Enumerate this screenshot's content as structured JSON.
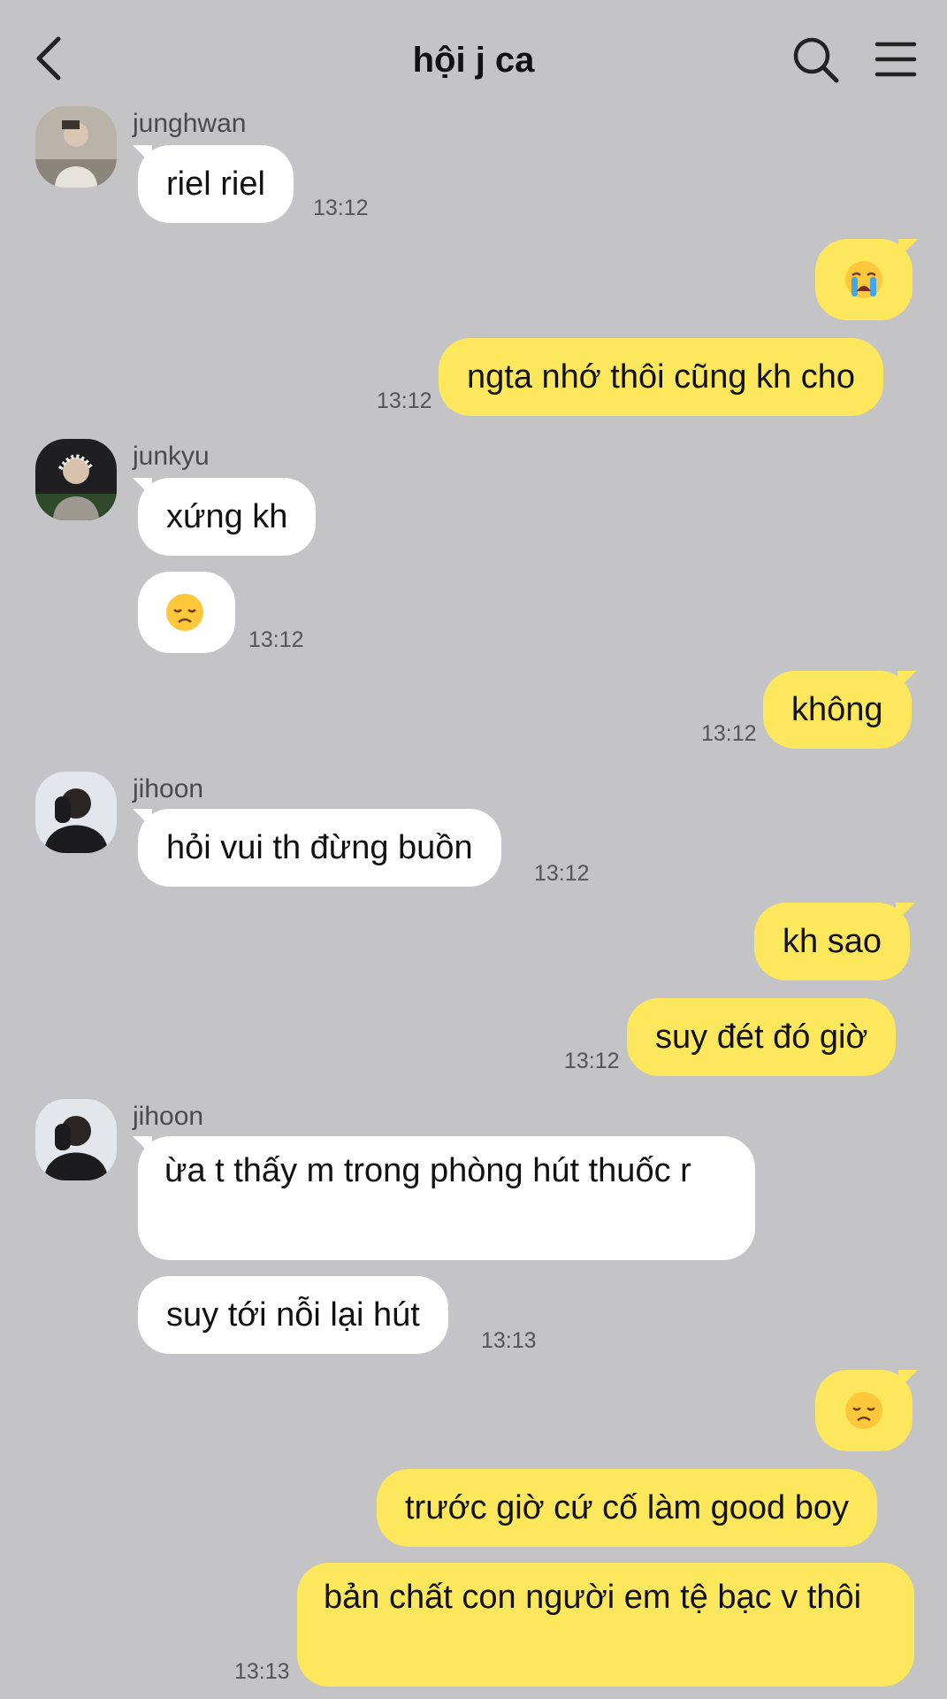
{
  "header": {
    "title": "hội j ca"
  },
  "colors": {
    "background": "#c4c4c6",
    "incoming_bubble": "#ffffff",
    "outgoing_bubble": "#fce75d"
  },
  "icons": [
    "back-arrow-icon",
    "search-icon",
    "menu-icon",
    "crying-emoji",
    "disappointed-emoji"
  ],
  "messages": [
    {
      "sender": "junghwan",
      "text": "riel riel",
      "time": "13:12"
    },
    {
      "emoji": "loudly-crying-face"
    },
    {
      "text": "ngta nhớ thôi cũng kh cho",
      "time": "13:12"
    },
    {
      "sender": "junkyu",
      "text": "xứng kh"
    },
    {
      "emoji": "disappointed-face",
      "time": "13:12"
    },
    {
      "text": "không",
      "time": "13:12"
    },
    {
      "sender": "jihoon",
      "text": "hỏi vui th đừng buồn",
      "time": "13:12"
    },
    {
      "text": "kh sao"
    },
    {
      "text": "suy đét đó giờ",
      "time": "13:12"
    },
    {
      "sender": "jihoon",
      "text": "ừa t thấy m trong phòng hút thuốc r"
    },
    {
      "text": "suy tới nỗi lại hút",
      "time": "13:13"
    },
    {
      "emoji": "disappointed-face"
    },
    {
      "text": "trước giờ cứ cố làm good boy"
    },
    {
      "text": "bản chất con người em tệ bạc v thôi",
      "time": "13:13"
    }
  ]
}
